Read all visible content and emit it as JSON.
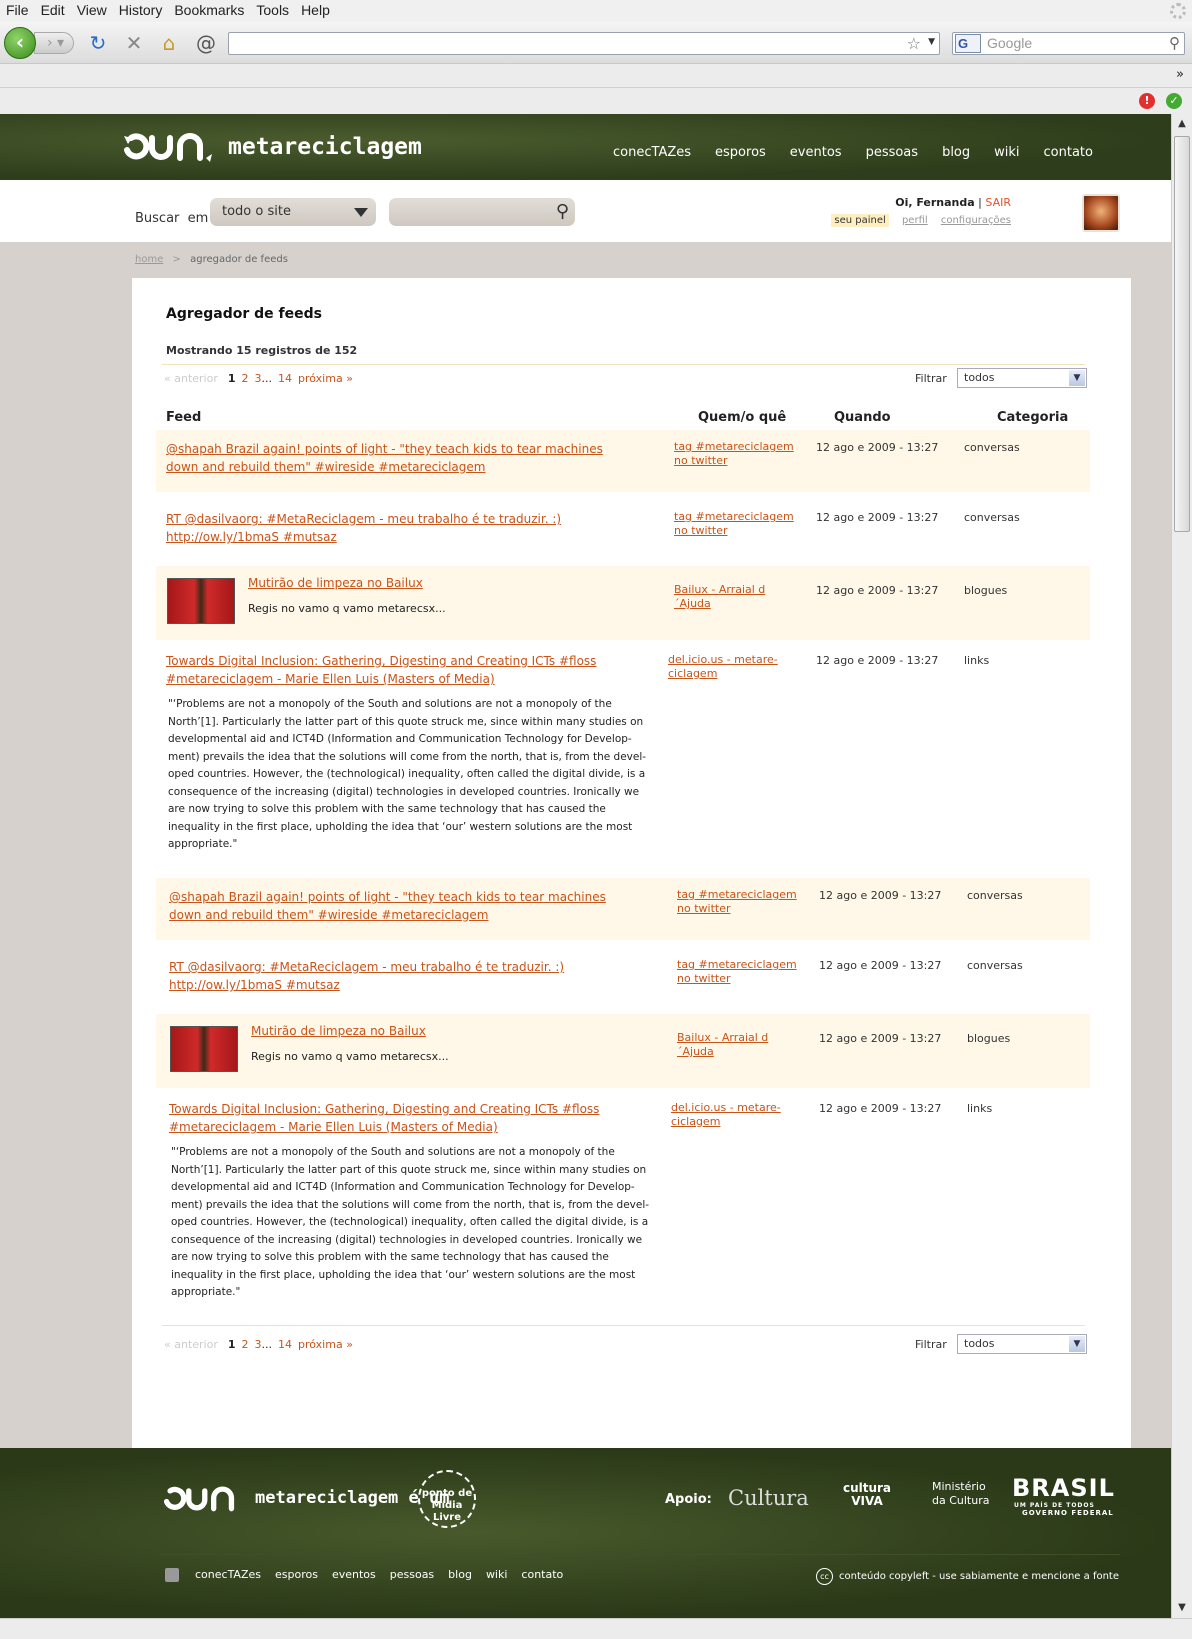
{
  "browser": {
    "menu": [
      "File",
      "Edit",
      "View",
      "History",
      "Bookmarks",
      "Tools",
      "Help"
    ],
    "search_placeholder": "Google",
    "search_engine_icon": "G",
    "overflow": "»"
  },
  "site": {
    "logo_text": "metareciclagem",
    "nav": [
      "conecTAZes",
      "esporos",
      "eventos",
      "pessoas",
      "blog",
      "wiki",
      "contato"
    ],
    "search_label": "Buscar",
    "search_in": "em",
    "scope_value": "todo o site",
    "user": {
      "greeting": "Oi, Fernanda",
      "sep": " | ",
      "logout": "SAIR",
      "panel": "seu painel",
      "profile": "perfil",
      "settings": "configurações"
    },
    "breadcrumb": {
      "home": "home",
      "sep": ">",
      "current": "agregador de feeds"
    }
  },
  "main": {
    "title": "Agregador de feeds",
    "showing": "Mostrando 15 registros de 152",
    "pager": {
      "prev": "« anterior",
      "current": "1",
      "pages": [
        "2",
        "3"
      ],
      "ellipsis": "...",
      "last": "14",
      "next": "próxima »"
    },
    "filter_label": "Filtrar",
    "filter_value": "todos",
    "columns": [
      "Feed",
      "Quem/o quê",
      "Quando",
      "Categoria"
    ],
    "rows": [
      {
        "feed": "@shapah Brazil again! points of light - \"they teach kids to tear machines down and rebuild them\" #wireside #metareciclagem",
        "who": "tag #metareciclagem no twitter",
        "when": "12 ago e 2009 - 13:27",
        "cat": "conversas"
      },
      {
        "feed": "RT @dasilvaorg: #MetaReciclagem - meu trabalho é te traduzir. :) http://ow.ly/1bmaS #mutsaz",
        "who": "tag #metareciclagem no twitter",
        "when": "12 ago e 2009 - 13:27",
        "cat": "conversas"
      },
      {
        "feed": "Mutirão de limpeza no Bailux",
        "excerpt": "Regis no vamo q vamo metarecsx...",
        "who": "Bailux - Arraial d´Ajuda",
        "when": "12 ago e 2009 - 13:27",
        "cat": "blogues"
      },
      {
        "feed": "Towards Digital Inclusion: Gathering, Digesting and Creating ICTs #floss #metareciclagem - Marie Ellen Luis (Masters of Media)",
        "quote": "\"‘Problems are not a monopoly of the South and solutions are not a monopoly of the North’[1]. Particularly the latter part of this quote struck me, since within many studies on developmental aid and ICT4D (Information and Communication Technology for Develop-ment) prevails the idea that the solutions will come from the north, that is, from the devel-oped countries. However, the (technological) inequality, often called the digital divide, is a consequence of the increasing (digital) technologies in developed countries. Ironically we are now trying to solve this problem with the same technology that has caused the inequality in the first place, upholding the idea that ‘our’ western solutions are the most appropriate.\"",
        "who": "del.icio.us - metare-ciclagem",
        "when": "12 ago e 2009 - 13:27",
        "cat": "links"
      },
      {
        "feed": "@shapah Brazil again! points of light - \"they teach kids to tear machines down and rebuild them\" #wireside #metareciclagem",
        "who": "tag #metareciclagem no twitter",
        "when": "12 ago e 2009 - 13:27",
        "cat": "conversas"
      },
      {
        "feed": "RT @dasilvaorg: #MetaReciclagem - meu trabalho é te traduzir. :) http://ow.ly/1bmaS #mutsaz",
        "who": "tag #metareciclagem no twitter",
        "when": "12 ago e 2009 - 13:27",
        "cat": "conversas"
      },
      {
        "feed": "Mutirão de limpeza no Bailux",
        "excerpt": "Regis no vamo q vamo metarecsx...",
        "who": "Bailux - Arraial d´Ajuda",
        "when": "12 ago e 2009 - 13:27",
        "cat": "blogues"
      },
      {
        "feed": "Towards Digital Inclusion: Gathering, Digesting and Creating ICTs #floss #metareciclagem - Marie Ellen Luis (Masters of Media)",
        "quote": "\"‘Problems are not a monopoly of the South and solutions are not a monopoly of the North’[1]. Particularly the latter part of this quote struck me, since within many studies on developmental aid and ICT4D (Information and Communication Technology for Develop-ment) prevails the idea that the solutions will come from the north, that is, from the devel-oped countries. However, the (technological) inequality, often called the digital divide, is a consequence of the increasing (digital) technologies in developed countries. Ironically we are now trying to solve this problem with the same technology that has caused the inequality in the first place, upholding the idea that ‘our’ western solutions are the most appropriate.\"",
        "who": "del.icio.us - metare-ciclagem",
        "when": "12 ago e 2009 - 13:27",
        "cat": "links"
      }
    ]
  },
  "footer": {
    "logo_text": "metareciclagem é um",
    "midia": "ponto de Mídia Livre",
    "apoio": "Apoio:",
    "sponsors": [
      "Cultura",
      "cultura VIVA",
      "Ministério da Cultura",
      "BRASIL",
      "UM PAÍS DE TODOS",
      "GOVERNO FEDERAL"
    ],
    "nav": [
      "conecTAZes",
      "esporos",
      "eventos",
      "pessoas",
      "blog",
      "wiki",
      "contato"
    ],
    "copyleft": "conteúdo copyleft - use sabiamente e mencione a fonte",
    "cc": "cc"
  },
  "colors": {
    "accent": "#c8541a",
    "header_green": "#3a4a22",
    "row_highlight": "#fff8e8",
    "sair": "#e0522a"
  }
}
